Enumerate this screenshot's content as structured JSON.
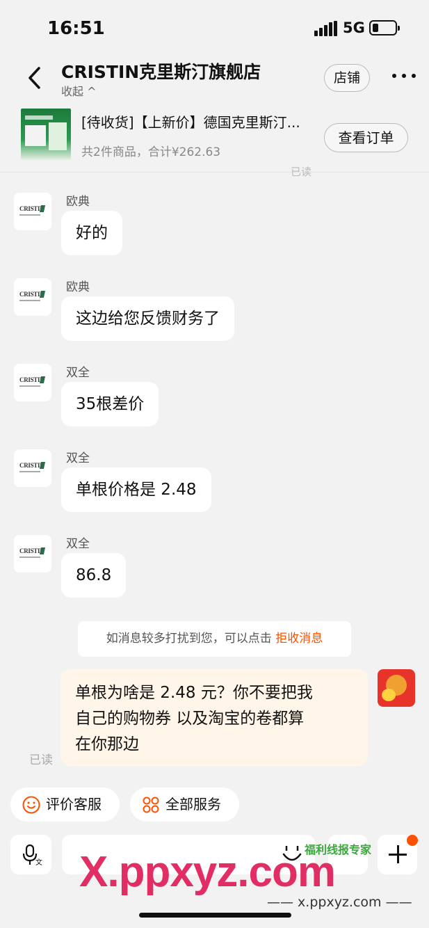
{
  "status_bar": {
    "time": "16:51",
    "network": "5G"
  },
  "header": {
    "shop_name": "CRISTIN克里斯汀旗舰店",
    "collapse_label": "收起 ^",
    "shop_button": "店铺"
  },
  "order": {
    "title": "[待收货]【上新价】德国克里斯汀...",
    "summary": "共2件商品，合计¥262.63",
    "view_button": "查看订单"
  },
  "top_read_label": "已读",
  "avatar_logo_text": "CRISTIN",
  "messages": [
    {
      "sender": "欧典",
      "text": "好的"
    },
    {
      "sender": "欧典",
      "text": "这边给您反馈财务了"
    },
    {
      "sender": "双全",
      "text": "35根差价"
    },
    {
      "sender": "双全",
      "text": "单根价格是 2.48"
    },
    {
      "sender": "双全",
      "text": "86.8"
    }
  ],
  "notice": {
    "text": "如消息较多打扰到您，可以点击 ",
    "link": "拒收消息"
  },
  "my_message": {
    "lines": [
      "单根为啥是 2.48 元？你不要把我",
      "自己的购物券 以及淘宝的卷都算",
      "在你那边"
    ],
    "read_label": "已读"
  },
  "quick_actions": [
    {
      "label": "评价客服",
      "icon": "smile-icon"
    },
    {
      "label": "全部服务",
      "icon": "grid-icon"
    }
  ],
  "watermark": {
    "big": "X.ppxyz.com",
    "small": "—— x.ppxyz.com ——",
    "badge": "福利线报专家"
  },
  "colors": {
    "accent": "#ff5000",
    "my_bubble": "#fff6e9",
    "watermark": "#e0245e"
  }
}
